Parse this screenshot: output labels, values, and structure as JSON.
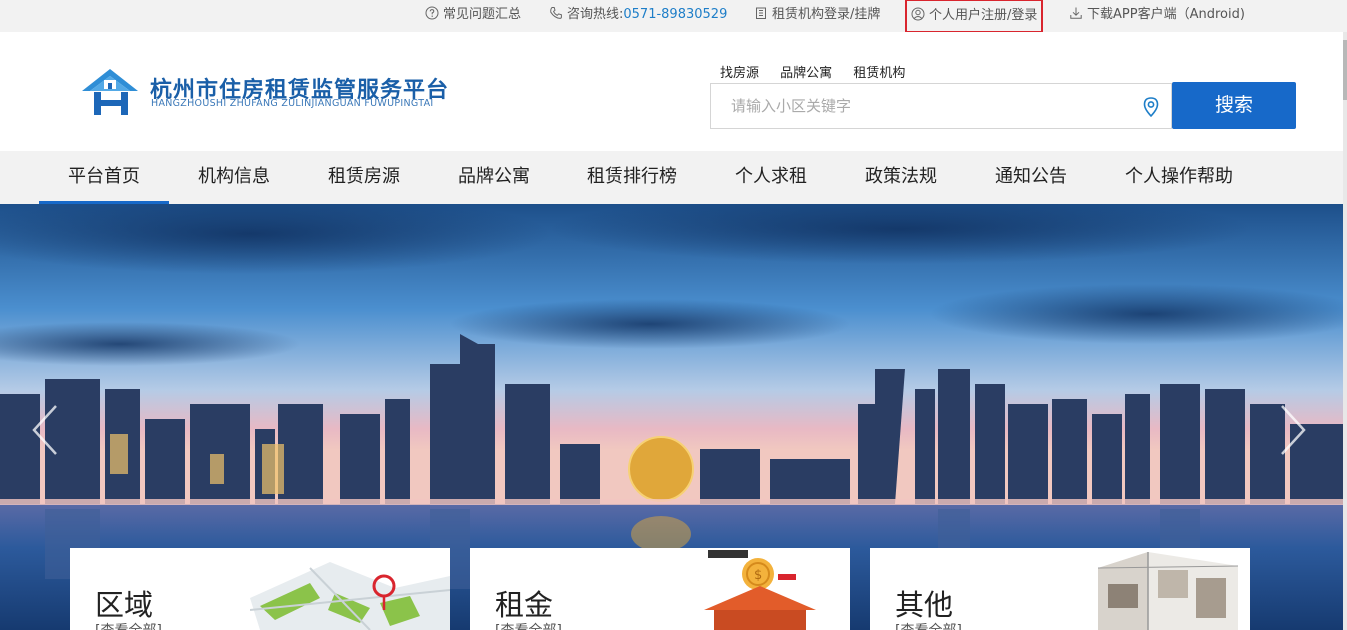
{
  "topbar": {
    "faq": "常见问题汇总",
    "hotline_label": "咨询热线:",
    "hotline_number": "0571-89830529",
    "agency_login": "租赁机构登录/挂牌",
    "personal_login": "个人用户注册/登录",
    "download_app": "下载APP客户端（Android)"
  },
  "header": {
    "logo_title": "杭州市住房租赁监管服务平台",
    "logo_subtitle": "HANGZHOUSHI ZHUFANG ZULINJIANGUAN FUWUPINGTAI",
    "quick_links": [
      "找房源",
      "品牌公寓",
      "租赁机构"
    ],
    "search_placeholder": "请输入小区关键字",
    "search_button": "搜索"
  },
  "nav": {
    "items": [
      "平台首页",
      "机构信息",
      "租赁房源",
      "品牌公寓",
      "租赁排行榜",
      "个人求租",
      "政策法规",
      "通知公告",
      "个人操作帮助"
    ],
    "active_index": 0
  },
  "cards": [
    {
      "title": "区域",
      "link": "[查看全部]"
    },
    {
      "title": "租金",
      "link": "[查看全部]"
    },
    {
      "title": "其他",
      "link": "[查看全部]"
    }
  ],
  "colors": {
    "brand_blue": "#1769c9",
    "hotline_blue": "#1e7ec8",
    "highlight_red": "#d9252e"
  }
}
